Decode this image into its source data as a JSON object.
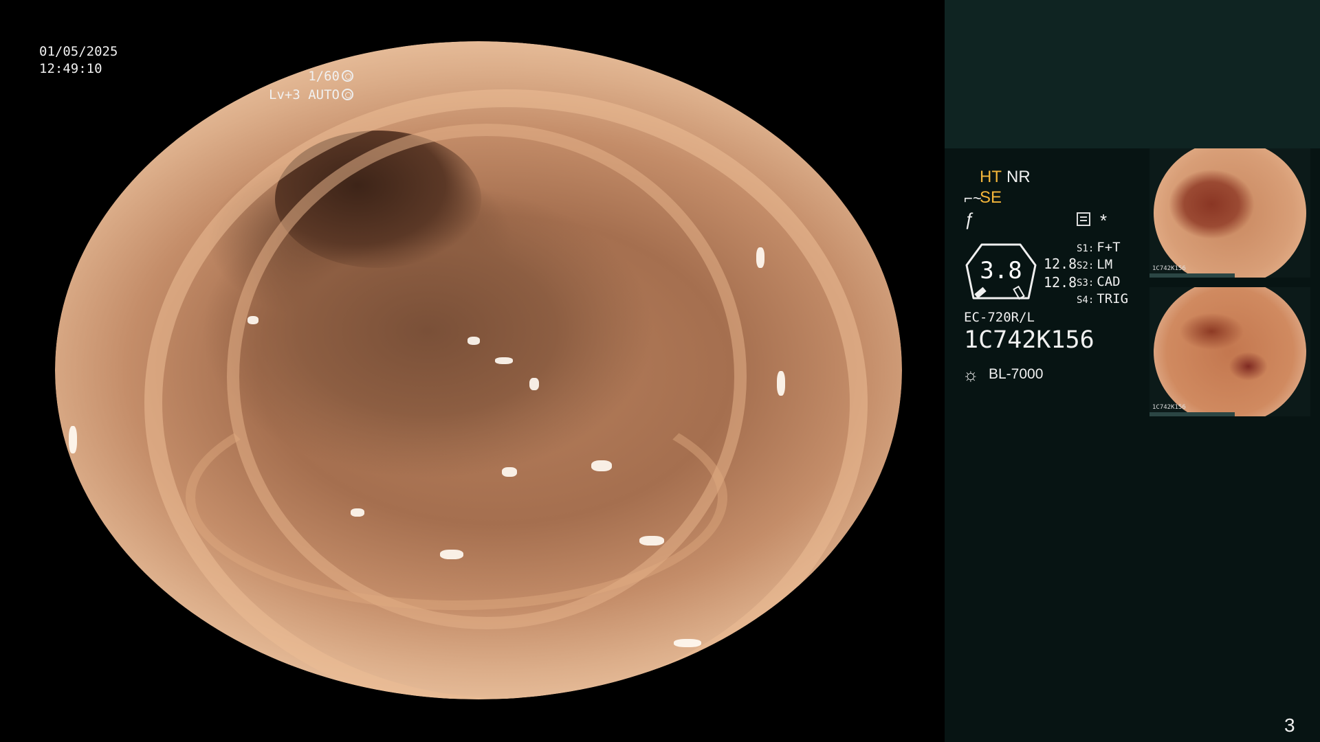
{
  "overlay": {
    "date": "01/05/2025",
    "time": "12:49:10",
    "shutter": "1/60",
    "level": "Lv+3 AUTO"
  },
  "panel": {
    "ht": "HT",
    "nr": "NR",
    "se": "SE",
    "gauge_value": "3.8",
    "gauge_side_1": "12.8",
    "gauge_side_2": "12.8",
    "settings": [
      {
        "key": "S1:",
        "value": "F+T"
      },
      {
        "key": "S2:",
        "value": "LM"
      },
      {
        "key": "S3:",
        "value": "CAD"
      },
      {
        "key": "S4:",
        "value": "TRIG"
      }
    ],
    "scope_model": "EC-720R/L",
    "serial": "1C742K156",
    "light_source": "BL-7000",
    "star": "*",
    "page_number": "3"
  },
  "thumbnails": [
    {
      "label": "1C742K156"
    },
    {
      "label": "1C742K156"
    }
  ],
  "icons": {
    "shutter": "aperture-icon",
    "level": "auto-icon",
    "light": "sun-icon"
  },
  "colors": {
    "accent": "#f4b63a",
    "panel_bg": "#071413",
    "panel_top_bg": "#0f2422"
  }
}
